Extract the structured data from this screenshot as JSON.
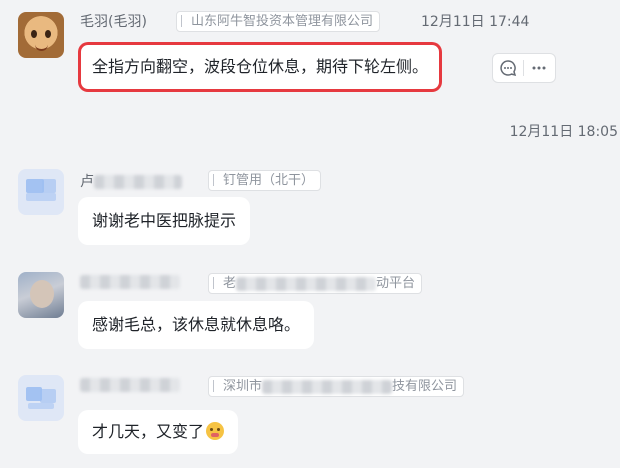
{
  "messages": [
    {
      "name": "毛羽(毛羽)",
      "org": "山东阿牛智投资本管理有限公司",
      "time": "12月11日 17:44",
      "text": "全指方向翻空，波段仓位休息，期待下轮左侧。",
      "highlighted": true,
      "actions": [
        "reply-icon",
        "more-icon"
      ]
    },
    {
      "name_visible": "卢",
      "org": "钉管用（北干）",
      "text": "谢谢老中医把脉提示"
    },
    {
      "org_prefix": "老",
      "org_suffix": "动平台",
      "text": "感谢毛总，该休息就休息咯。"
    },
    {
      "org_prefix": "深圳市",
      "org_suffix": "技有限公司",
      "text": "才几天，又变了",
      "emoji": "scream-emoji"
    }
  ],
  "time_divider": "12月11日 18:05",
  "colors": {
    "highlight": "#e6393f",
    "background": "#f2f3f5",
    "bubble": "#ffffff"
  }
}
